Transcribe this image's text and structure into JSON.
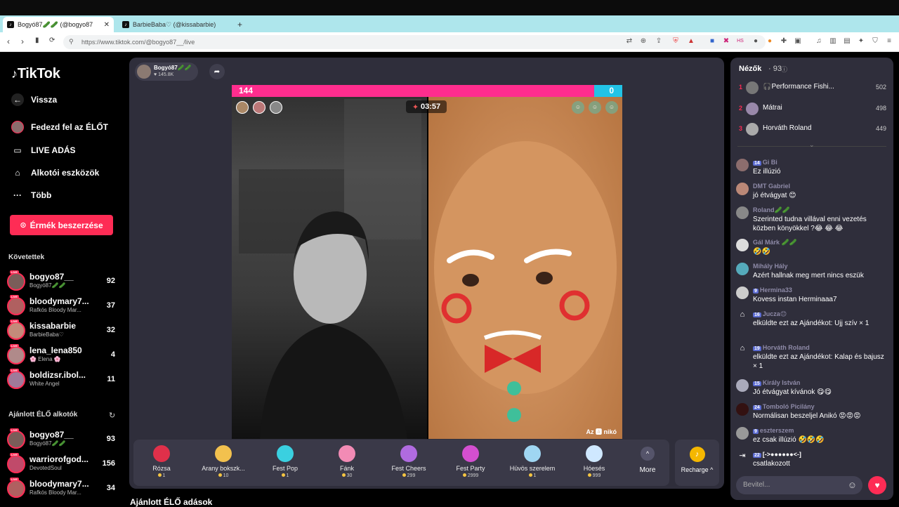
{
  "browser": {
    "tab1_title": "Bogyó87🥒🥒 (@bogyo87",
    "tab2_title": "BarbieBaba♡ (@kissabarbie) ÉLŐ",
    "new_tab": "+",
    "url": "https://www.tiktok.com/@bogyo87__/live"
  },
  "sidebar": {
    "logo": "TikTok",
    "back": "Vissza",
    "explore": "Fedezd fel az ÉLŐT",
    "live": "LIVE ADÁS",
    "creator": "Alkotói eszközök",
    "more": "Több",
    "coins_button": "Érmék beszerzése",
    "following_title": "Követettek",
    "following": [
      {
        "name": "bogyo87__",
        "sub": "Bogyó87🥒🥒",
        "count": "92"
      },
      {
        "name": "bloodymary7...",
        "sub": "Rafkós Bloody Mar...",
        "count": "37"
      },
      {
        "name": "kissabarbie",
        "sub": "BarbieBaba♡",
        "count": "32"
      },
      {
        "name": "lena_lena850",
        "sub": "🌸 Elena 🌸",
        "count": "4"
      },
      {
        "name": "boldizsr.ibol...",
        "sub": "White Angel",
        "count": "11"
      }
    ],
    "recommended_title": "Ajánlott ÉLŐ alkotók",
    "recommended": [
      {
        "name": "bogyo87__",
        "sub": "Bogyó87🥒🥒",
        "count": "93"
      },
      {
        "name": "warriorofgod...",
        "sub": "DevotedSoul",
        "count": "156"
      },
      {
        "name": "bloodymary7...",
        "sub": "Rafkós Bloody Mar...",
        "count": "34"
      }
    ]
  },
  "stage": {
    "host_name": "Bogyó87🥒🥒",
    "host_viewers": "145.8K",
    "score_left": "144",
    "score_right": "0",
    "timer": "03:57",
    "opponent_label": "Az 🅰 nikó"
  },
  "gifts": [
    {
      "name": "Rózsa",
      "price": "1",
      "color": "#e0304a"
    },
    {
      "name": "Arany bokszk...",
      "price": "10",
      "color": "#f2c14e"
    },
    {
      "name": "Fest Pop",
      "price": "1",
      "color": "#3ad0e0"
    },
    {
      "name": "Fánk",
      "price": "30",
      "color": "#f28bb5"
    },
    {
      "name": "Fest Cheers",
      "price": "299",
      "color": "#b06be0"
    },
    {
      "name": "Fest Party",
      "price": "2999",
      "color": "#d44fd0"
    },
    {
      "name": "Hüvös szerelem",
      "price": "1",
      "color": "#9fd6f2"
    },
    {
      "name": "Hóesés",
      "price": "999",
      "color": "#cfe8ff"
    }
  ],
  "more_label": "More",
  "recharge_label": "Recharge ^",
  "recommended_live_title": "Ajánlott ÉLŐ adások",
  "chat": {
    "viewers_title": "Nézők",
    "viewers_count": "· 93",
    "ranking": [
      {
        "rank": "1",
        "name": "🎧Performance Fishi...",
        "score": "502"
      },
      {
        "rank": "2",
        "name": "Mátrai",
        "score": "498"
      },
      {
        "rank": "3",
        "name": "Horváth Roland",
        "score": "449"
      }
    ],
    "messages": [
      {
        "badge": "14",
        "name": "Gi Bi",
        "text": "Ez illúzió"
      },
      {
        "badge": "",
        "name": "DMT Gabriel",
        "text": "jó étvágyat 😊"
      },
      {
        "badge": "",
        "name": "Roland🥒🥒",
        "text": "Szerinted tudna villával enni vezetés közben könyökkel ?😂 😂 😂"
      },
      {
        "badge": "",
        "name": "Gál Márk 🥒🥒",
        "text": "🤣🤣"
      },
      {
        "badge": "",
        "name": "Mihály Hály",
        "text": "Azért hallnak meg mert nincs eszük"
      },
      {
        "badge": "9",
        "name": "Hermina33",
        "text": "Kovess instan Herminaaa7"
      },
      {
        "badge": "16",
        "name": "Jucza😊",
        "text": "elküldte ezt az Ajándékot: Ujj szív × 1"
      },
      {
        "badge": "19",
        "name": "Horváth Roland",
        "text": "elküldte ezt az Ajándékot: Kalap és bajusz × 1"
      },
      {
        "badge": "15",
        "name": "Király István",
        "text": "Jó étvágyat kívánok 😋😋"
      },
      {
        "badge": "24",
        "name": "Tomboló Picilány",
        "text": "Normálisan beszeljel Anikó 😡😡😡"
      },
      {
        "badge": "9",
        "name": "eszterszem",
        "text": "ez csak illúzió 🤣🤣🤣"
      },
      {
        "badge": "22",
        "name": "[->●●●●●●<-]",
        "text": "csatlakozott"
      }
    ],
    "input_placeholder": "Bevitel..."
  }
}
